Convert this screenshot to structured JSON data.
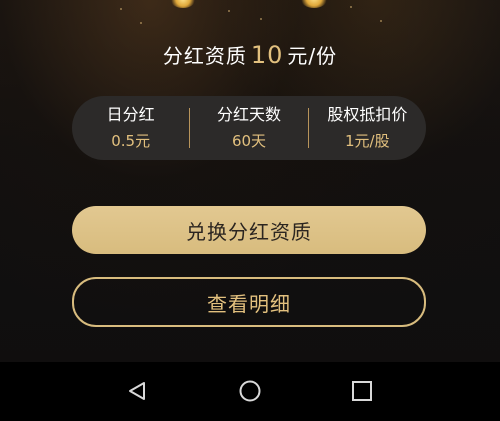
{
  "qualification": {
    "prefix": "分红资质",
    "value": "10",
    "unit": "元/份"
  },
  "stats": [
    {
      "label": "日分红",
      "value": "0.5元"
    },
    {
      "label": "分红天数",
      "value": "60天"
    },
    {
      "label": "股权抵扣价",
      "value": "1元/股"
    }
  ],
  "buttons": {
    "exchange": "兑换分红资质",
    "details": "查看明细"
  },
  "navbar": {
    "icons": [
      "back-triangle-icon",
      "home-circle-icon",
      "recent-apps-square-icon"
    ]
  },
  "colors": {
    "accent": "#e2c07e",
    "button": "#d8bc7e",
    "background": "#111010",
    "panel": "#2c2a29"
  }
}
